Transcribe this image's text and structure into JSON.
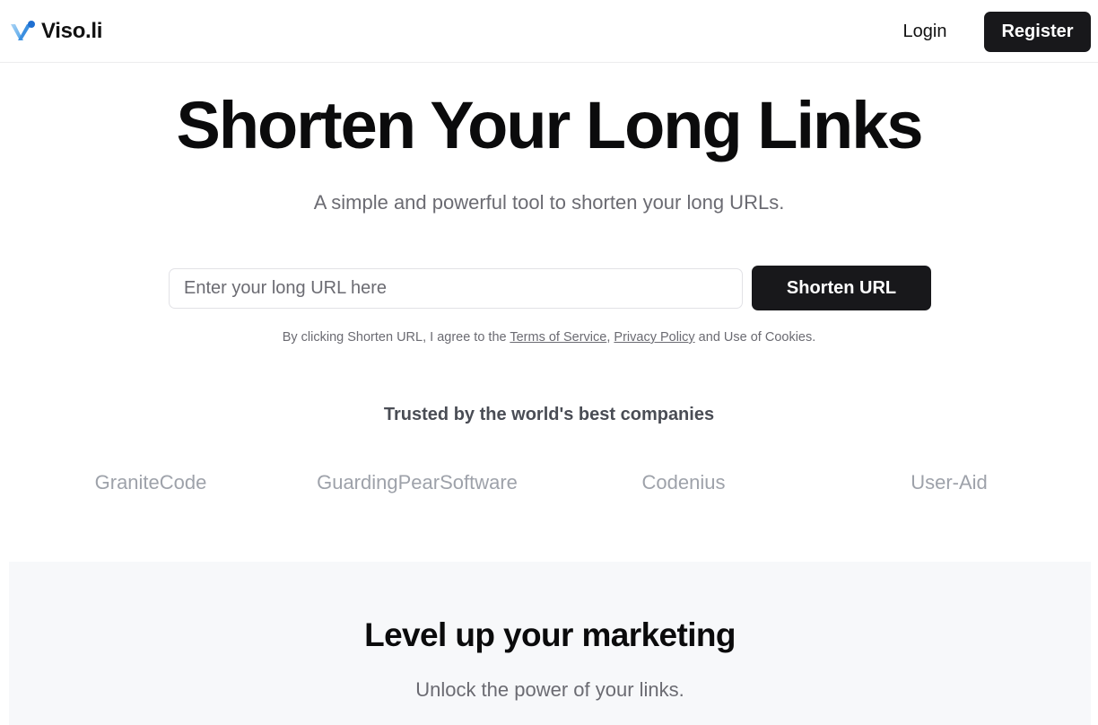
{
  "header": {
    "brand": "Viso.li",
    "logo_icon": "v-logo-icon",
    "login_label": "Login",
    "register_label": "Register",
    "accent_color": "#18181b"
  },
  "hero": {
    "title": "Shorten Your Long Links",
    "subtitle": "A simple and powerful tool to shorten your long URLs.",
    "input_placeholder": "Enter your long URL here",
    "input_value": "",
    "button_label": "Shorten URL",
    "legal": {
      "prefix": "By clicking Shorten URL, I agree to the ",
      "terms_label": "Terms of Service",
      "separator": ", ",
      "privacy_label": "Privacy Policy",
      "suffix": " and Use of Cookies."
    }
  },
  "trusted": {
    "heading": "Trusted by the world's best companies",
    "companies": [
      "GraniteCode",
      "GuardingPearSoftware",
      "Codenius",
      "User-Aid"
    ]
  },
  "marketing": {
    "title": "Level up your marketing",
    "subtitle": "Unlock the power of your links."
  }
}
